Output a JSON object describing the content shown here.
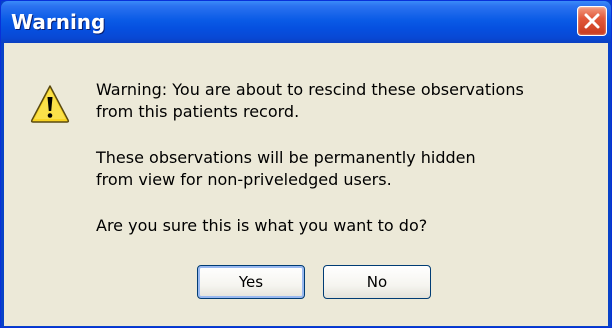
{
  "window": {
    "title": "Warning",
    "close_icon": "close-icon"
  },
  "dialog": {
    "icon": "warning-icon",
    "message_line1": "Warning: You are about to rescind these observations",
    "message_line2": "from this patients record.",
    "message_line3": "These observations will be permanently hidden",
    "message_line4": "from view for non-priveledged users.",
    "message_line5": "Are you sure this is what you want to do?",
    "yes_label": "Yes",
    "no_label": "No"
  },
  "colors": {
    "titlebar": "#0a5be6",
    "close_button": "#e2593b",
    "client_background": "#ece9d8",
    "warning_icon": "#f8d322"
  }
}
